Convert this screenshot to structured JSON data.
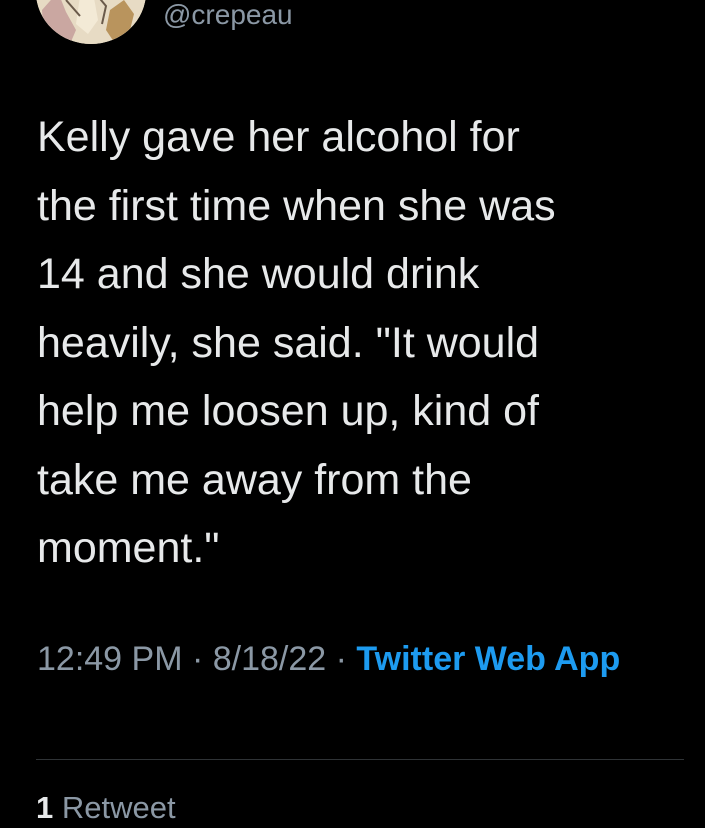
{
  "tweet": {
    "author": {
      "handle": "@crepeau"
    },
    "text": "Kelly gave her alcohol for\nthe first time when she was\n14 and she would drink\nheavily, she said. \"It would\nhelp me loosen up, kind of\ntake me away from the\nmoment.\"",
    "time": "12:49 PM",
    "separator": " · ",
    "date": "8/18/22",
    "source": "Twitter Web App",
    "stats": {
      "retweet_count": "1",
      "retweet_label": "Retweet"
    }
  },
  "colors": {
    "background": "#000000",
    "text": "#e7e9ea",
    "secondary_text": "#8b98a5",
    "link": "#1d9bf0",
    "divider": "#2f3336"
  }
}
